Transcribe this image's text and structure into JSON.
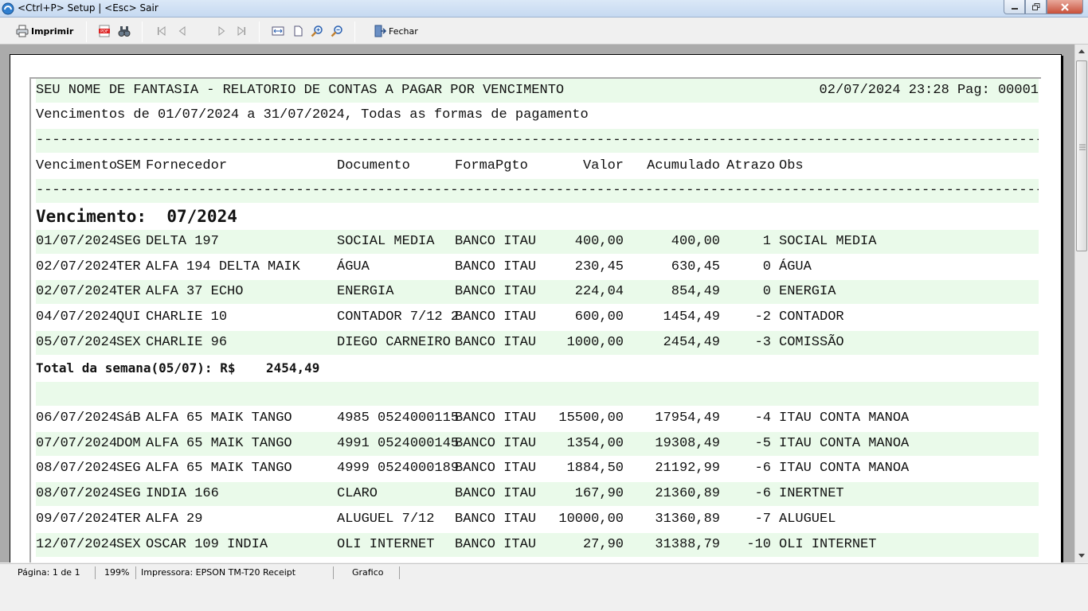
{
  "window": {
    "title": "<Ctrl+P> Setup | <Esc> Sair"
  },
  "toolbar": {
    "print_label": "Imprimir",
    "close_label": "Fechar"
  },
  "report": {
    "header_left": "SEU NOME DE FANTASIA - RELATORIO DE CONTAS A PAGAR POR VENCIMENTO",
    "header_right": "02/07/2024 23:28 Pag: 00001",
    "subtitle": "Vencimentos de 01/07/2024 a 31/07/2024, Todas as formas de pagamento",
    "separator": "---------------------------------------------------------------------------------------------------------------------------------------------",
    "columns": {
      "vencimento": "Vencimento",
      "sem": "SEM",
      "fornecedor": "Fornecedor",
      "documento": "Documento",
      "formapgto": "FormaPgto",
      "valor": "Valor",
      "acumulado": "Acumulado",
      "atrazo": "Atrazo",
      "obs": "Obs"
    },
    "group_title": "Vencimento:  07/2024",
    "week1": [
      {
        "data": "01/07/2024",
        "sem": "SEG",
        "fornecedor": "DELTA 197",
        "documento": "SOCIAL MEDIA",
        "forma": "BANCO ITAU",
        "valor": "400,00",
        "acumulado": "400,00",
        "atrazo": "1",
        "obs": "SOCIAL MEDIA"
      },
      {
        "data": "02/07/2024",
        "sem": "TER",
        "fornecedor": "ALFA 194 DELTA MAIK",
        "documento": "ÁGUA",
        "forma": "BANCO ITAU",
        "valor": "230,45",
        "acumulado": "630,45",
        "atrazo": "0",
        "obs": "ÁGUA"
      },
      {
        "data": "02/07/2024",
        "sem": "TER",
        "fornecedor": "ALFA 37 ECHO",
        "documento": "ENERGIA",
        "forma": "BANCO ITAU",
        "valor": "224,04",
        "acumulado": "854,49",
        "atrazo": "0",
        "obs": "ENERGIA"
      },
      {
        "data": "04/07/2024",
        "sem": "QUI",
        "fornecedor": "CHARLIE 10",
        "documento": "CONTADOR 7/12 2",
        "forma": "BANCO ITAU",
        "valor": "600,00",
        "acumulado": "1454,49",
        "atrazo": "-2",
        "obs": "CONTADOR"
      },
      {
        "data": "05/07/2024",
        "sem": "SEX",
        "fornecedor": "CHARLIE 96",
        "documento": "DIEGO CARNEIRO",
        "forma": "BANCO ITAU",
        "valor": "1000,00",
        "acumulado": "2454,49",
        "atrazo": "-3",
        "obs": "COMISSÃO"
      }
    ],
    "week1_total": "Total da semana(05/07): R$    2454,49",
    "week2": [
      {
        "data": "06/07/2024",
        "sem": "SáB",
        "fornecedor": "ALFA 65 MAIK TANGO",
        "documento": "4985 0524000115",
        "forma": "BANCO ITAU",
        "valor": "15500,00",
        "acumulado": "17954,49",
        "atrazo": "-4",
        "obs": "ITAU CONTA MANOA"
      },
      {
        "data": "07/07/2024",
        "sem": "DOM",
        "fornecedor": "ALFA 65 MAIK TANGO",
        "documento": "4991 0524000145",
        "forma": "BANCO ITAU",
        "valor": "1354,00",
        "acumulado": "19308,49",
        "atrazo": "-5",
        "obs": "ITAU CONTA MANOA"
      },
      {
        "data": "08/07/2024",
        "sem": "SEG",
        "fornecedor": "ALFA 65 MAIK TANGO",
        "documento": "4999 0524000189",
        "forma": "BANCO ITAU",
        "valor": "1884,50",
        "acumulado": "21192,99",
        "atrazo": "-6",
        "obs": "ITAU CONTA MANOA"
      },
      {
        "data": "08/07/2024",
        "sem": "SEG",
        "fornecedor": "INDIA 166",
        "documento": "CLARO",
        "forma": "BANCO ITAU",
        "valor": "167,90",
        "acumulado": "21360,89",
        "atrazo": "-6",
        "obs": "INERTNET"
      },
      {
        "data": "09/07/2024",
        "sem": "TER",
        "fornecedor": "ALFA 29",
        "documento": "ALUGUEL 7/12",
        "forma": "BANCO ITAU",
        "valor": "10000,00",
        "acumulado": "31360,89",
        "atrazo": "-7",
        "obs": "ALUGUEL"
      },
      {
        "data": "12/07/2024",
        "sem": "SEX",
        "fornecedor": "OSCAR 109 INDIA",
        "documento": "OLI INTERNET",
        "forma": "BANCO ITAU",
        "valor": "27,90",
        "acumulado": "31388,79",
        "atrazo": "-10",
        "obs": "OLI INTERNET"
      }
    ]
  },
  "status": {
    "page": "Página: 1 de 1",
    "zoom": "199%",
    "printer": "Impressora: EPSON TM-T20 Receipt",
    "mode": "Grafico"
  },
  "colors": {
    "band": "#eafaea",
    "titlebar": "#c6d9f1",
    "close_button": "#c8503a"
  }
}
